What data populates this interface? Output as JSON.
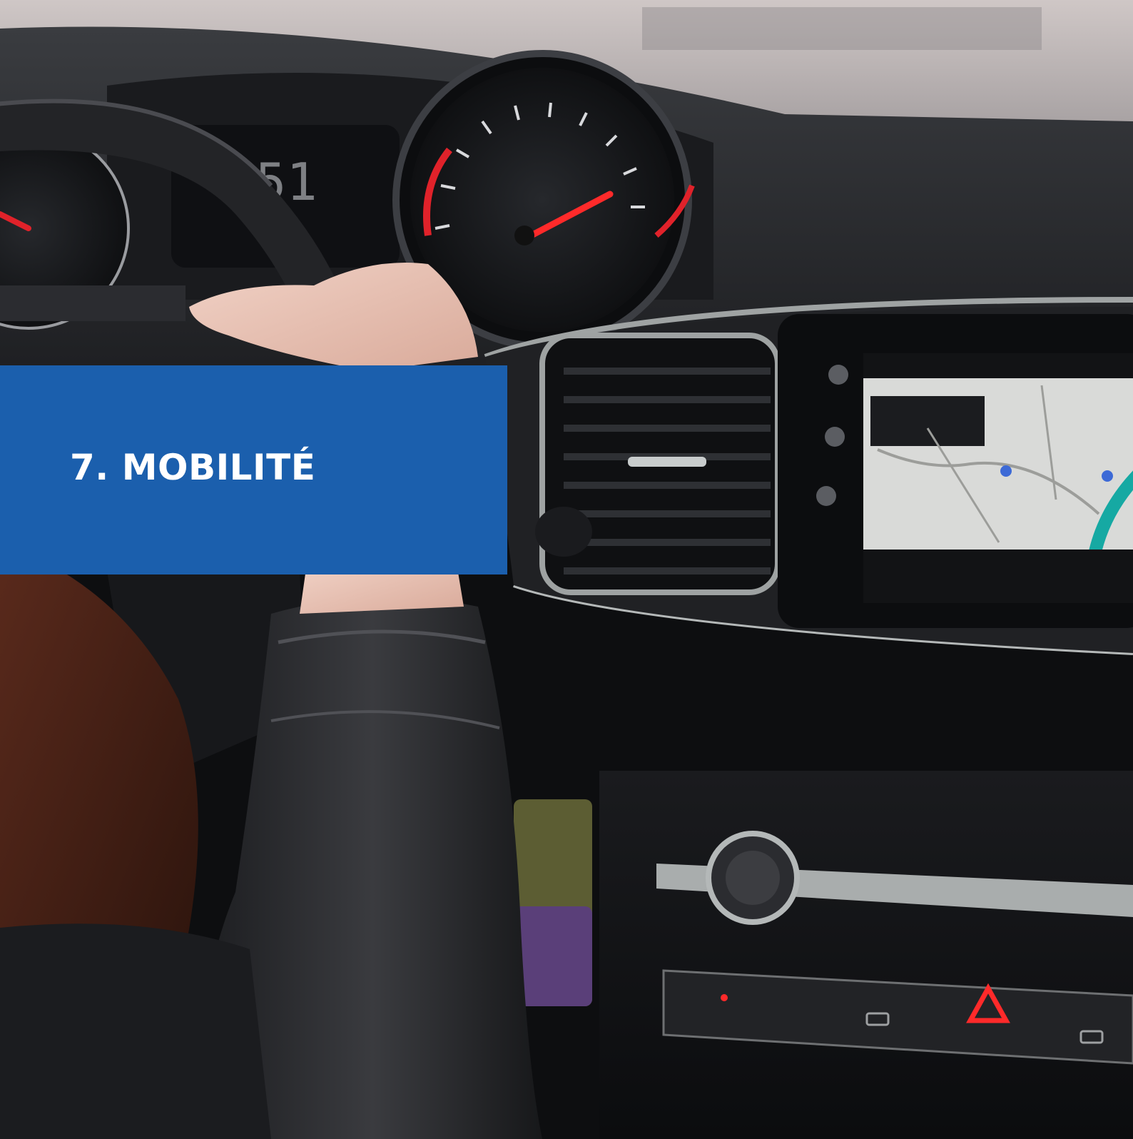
{
  "section": {
    "title": "7. MOBILITÉ",
    "accent_color": "#1b5fad"
  },
  "photo": {
    "subject": "car-interior-dashboard",
    "speed_readout": "51"
  }
}
